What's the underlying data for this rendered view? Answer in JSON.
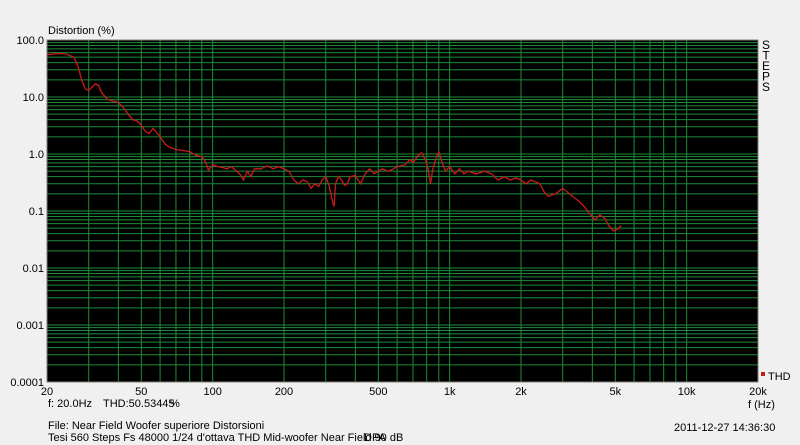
{
  "chart_data": {
    "type": "line",
    "title": "Distortion (%)",
    "ylabel": "Distortion (%)",
    "xlabel": "f (Hz)",
    "x_scale": "log",
    "y_scale": "log",
    "xlim": [
      20,
      20000
    ],
    "ylim": [
      0.0001,
      100
    ],
    "grid": true,
    "background_color": "#000000",
    "grid_color": "#1e8c3a",
    "x_tick_labels": [
      {
        "value": 20,
        "label": "20"
      },
      {
        "value": 50,
        "label": "50"
      },
      {
        "value": 100,
        "label": "100"
      },
      {
        "value": 200,
        "label": "200"
      },
      {
        "value": 500,
        "label": "500"
      },
      {
        "value": 1000,
        "label": "1k"
      },
      {
        "value": 2000,
        "label": "2k"
      },
      {
        "value": 5000,
        "label": "5k"
      },
      {
        "value": 10000,
        "label": "10k"
      },
      {
        "value": 20000,
        "label": "20k"
      }
    ],
    "y_tick_labels": [
      {
        "value": 100,
        "label": "100.0"
      },
      {
        "value": 10,
        "label": "10.0"
      },
      {
        "value": 1,
        "label": "1.0"
      },
      {
        "value": 0.1,
        "label": "0.1"
      },
      {
        "value": 0.01,
        "label": "0.01"
      },
      {
        "value": 0.001,
        "label": "0.001"
      },
      {
        "value": 0.0001,
        "label": "0.0001"
      }
    ],
    "legend_position": "bottom-right",
    "series": [
      {
        "name": "THD",
        "color": "#cc1a1a",
        "points": [
          [
            20,
            55
          ],
          [
            22,
            58
          ],
          [
            24,
            57
          ],
          [
            26,
            50
          ],
          [
            27,
            35
          ],
          [
            28,
            20
          ],
          [
            29,
            14
          ],
          [
            30,
            13
          ],
          [
            31,
            15
          ],
          [
            32,
            17
          ],
          [
            33,
            16
          ],
          [
            34,
            12
          ],
          [
            36,
            9
          ],
          [
            38,
            8.5
          ],
          [
            40,
            8
          ],
          [
            42,
            6.5
          ],
          [
            44,
            5
          ],
          [
            46,
            4
          ],
          [
            48,
            3.8
          ],
          [
            50,
            3.2
          ],
          [
            52,
            2.5
          ],
          [
            54,
            2.3
          ],
          [
            56,
            2.8
          ],
          [
            58,
            2.4
          ],
          [
            60,
            2
          ],
          [
            63,
            1.5
          ],
          [
            66,
            1.3
          ],
          [
            70,
            1.2
          ],
          [
            75,
            1.15
          ],
          [
            80,
            1.1
          ],
          [
            85,
            0.95
          ],
          [
            90,
            0.9
          ],
          [
            93,
            0.75
          ],
          [
            96,
            0.52
          ],
          [
            100,
            0.65
          ],
          [
            105,
            0.6
          ],
          [
            110,
            0.58
          ],
          [
            115,
            0.55
          ],
          [
            120,
            0.6
          ],
          [
            125,
            0.52
          ],
          [
            130,
            0.45
          ],
          [
            135,
            0.35
          ],
          [
            140,
            0.5
          ],
          [
            145,
            0.4
          ],
          [
            150,
            0.55
          ],
          [
            160,
            0.55
          ],
          [
            170,
            0.62
          ],
          [
            180,
            0.55
          ],
          [
            190,
            0.6
          ],
          [
            200,
            0.55
          ],
          [
            210,
            0.5
          ],
          [
            220,
            0.35
          ],
          [
            230,
            0.3
          ],
          [
            240,
            0.35
          ],
          [
            250,
            0.33
          ],
          [
            260,
            0.25
          ],
          [
            270,
            0.3
          ],
          [
            280,
            0.27
          ],
          [
            290,
            0.35
          ],
          [
            300,
            0.4
          ],
          [
            310,
            0.28
          ],
          [
            320,
            0.15
          ],
          [
            325,
            0.12
          ],
          [
            330,
            0.3
          ],
          [
            340,
            0.4
          ],
          [
            350,
            0.35
          ],
          [
            360,
            0.28
          ],
          [
            370,
            0.3
          ],
          [
            380,
            0.4
          ],
          [
            400,
            0.42
          ],
          [
            420,
            0.3
          ],
          [
            440,
            0.45
          ],
          [
            460,
            0.55
          ],
          [
            480,
            0.45
          ],
          [
            500,
            0.5
          ],
          [
            520,
            0.55
          ],
          [
            550,
            0.5
          ],
          [
            580,
            0.55
          ],
          [
            600,
            0.6
          ],
          [
            650,
            0.65
          ],
          [
            680,
            0.8
          ],
          [
            700,
            0.7
          ],
          [
            730,
            0.9
          ],
          [
            760,
            1.05
          ],
          [
            790,
            0.8
          ],
          [
            810,
            0.55
          ],
          [
            830,
            0.3
          ],
          [
            850,
            0.55
          ],
          [
            880,
            0.9
          ],
          [
            900,
            1.1
          ],
          [
            930,
            0.7
          ],
          [
            960,
            0.5
          ],
          [
            1000,
            0.6
          ],
          [
            1050,
            0.45
          ],
          [
            1100,
            0.55
          ],
          [
            1150,
            0.45
          ],
          [
            1200,
            0.5
          ],
          [
            1300,
            0.45
          ],
          [
            1400,
            0.5
          ],
          [
            1500,
            0.45
          ],
          [
            1600,
            0.35
          ],
          [
            1700,
            0.4
          ],
          [
            1800,
            0.35
          ],
          [
            1900,
            0.38
          ],
          [
            2000,
            0.35
          ],
          [
            2100,
            0.3
          ],
          [
            2200,
            0.35
          ],
          [
            2400,
            0.3
          ],
          [
            2500,
            0.22
          ],
          [
            2600,
            0.18
          ],
          [
            2800,
            0.2
          ],
          [
            3000,
            0.25
          ],
          [
            3200,
            0.2
          ],
          [
            3500,
            0.15
          ],
          [
            3700,
            0.12
          ],
          [
            3900,
            0.09
          ],
          [
            4100,
            0.07
          ],
          [
            4300,
            0.085
          ],
          [
            4500,
            0.075
          ],
          [
            4700,
            0.055
          ],
          [
            4900,
            0.045
          ],
          [
            5100,
            0.048
          ],
          [
            5300,
            0.055
          ]
        ]
      }
    ]
  },
  "side_label": "STEPS",
  "readout": {
    "freq": "f: 20.0Hz",
    "thd": "THD:50.53445",
    "unit": "%"
  },
  "footer": {
    "file_line": "File: Near Field Woofer superiore Distorsioni",
    "desc_line": "Tesi 560 Steps Fs 48000 1/24 d'ottava THD Mid-woofer Near Field 90 dB",
    "dpa": "DPA",
    "timestamp": "2011-12-27 14:36:30"
  }
}
